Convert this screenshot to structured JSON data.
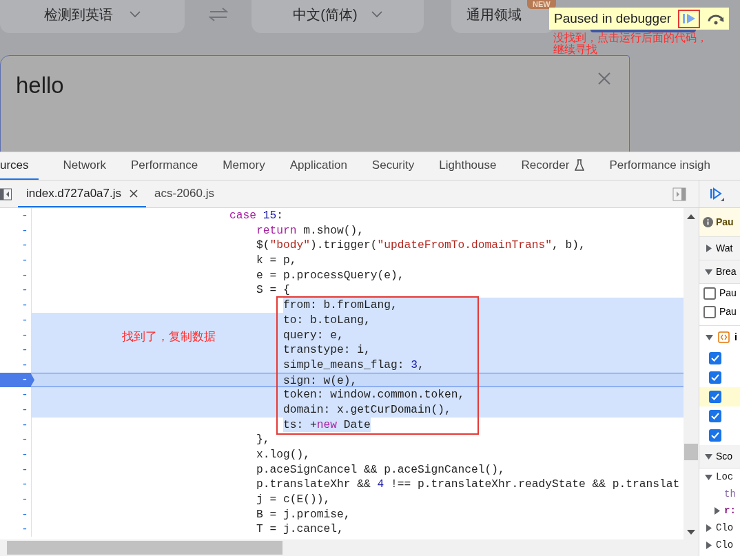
{
  "page": {
    "source_lang": "检测到英语",
    "target_lang": "中文(简体)",
    "domain": "通用领域",
    "badge": "NEW",
    "input_text": "hello"
  },
  "debugger_banner": {
    "text": "Paused in debugger"
  },
  "callout": {
    "lines": [
      "没找到，点击运行后面的代码，",
      "继续寻找"
    ]
  },
  "devtools_tabs": [
    {
      "label": "urces",
      "selected": true,
      "experimental": false
    },
    {
      "label": "Network",
      "selected": false,
      "experimental": false
    },
    {
      "label": "Performance",
      "selected": false,
      "experimental": false
    },
    {
      "label": "Memory",
      "selected": false,
      "experimental": false
    },
    {
      "label": "Application",
      "selected": false,
      "experimental": false
    },
    {
      "label": "Security",
      "selected": false,
      "experimental": false
    },
    {
      "label": "Lighthouse",
      "selected": false,
      "experimental": false
    },
    {
      "label": "Recorder",
      "selected": false,
      "experimental": true
    },
    {
      "label": "Performance insigh",
      "selected": false,
      "experimental": false
    }
  ],
  "file_tabs": [
    {
      "label": "index.d727a0a7.js",
      "selected": true,
      "closable": true
    },
    {
      "label": "acs-2060.js",
      "selected": false,
      "closable": false
    }
  ],
  "code": {
    "note": "找到了，复制数据",
    "lines": [
      {
        "marker": "-",
        "selected": false,
        "current": false,
        "tokens": [
          {
            "kind": "keyword",
            "text": "case"
          },
          {
            "kind": "number",
            "text": " 15"
          },
          {
            "kind": "plain",
            "text": ":"
          }
        ],
        "children": [
          {
            "marker": "-",
            "selected": false,
            "current": false,
            "tokens": [
              {
                "kind": "keyword",
                "text": "return"
              },
              {
                "kind": "plain",
                "text": " m.show(),"
              }
            ]
          },
          {
            "marker": "-",
            "selected": false,
            "current": false,
            "tokens": [
              {
                "kind": "plain",
                "text": "$("
              },
              {
                "kind": "string",
                "text": "\"body\""
              },
              {
                "kind": "plain",
                "text": ").trigger("
              },
              {
                "kind": "string",
                "text": "\"updateFromTo.domainTrans\""
              },
              {
                "kind": "plain",
                "text": ", b),"
              }
            ]
          },
          {
            "marker": "-",
            "selected": false,
            "current": false,
            "tokens": [
              {
                "kind": "plain",
                "text": "k = p,"
              }
            ]
          },
          {
            "marker": "-",
            "selected": false,
            "current": false,
            "tokens": [
              {
                "kind": "plain",
                "text": "e = p.processQuery(e),"
              }
            ]
          },
          {
            "marker": "-",
            "selected": false,
            "current": false,
            "tokens": [
              {
                "kind": "plain",
                "text": "S = {"
              }
            ],
            "children": [
              {
                "marker": "-",
                "selected": true,
                "current": false,
                "tokens": [
                  {
                    "kind": "plain",
                    "text": "from: b.fromLang,"
                  }
                ]
              },
              {
                "marker": "-",
                "selected": true,
                "current": false,
                "tokens": [
                  {
                    "kind": "plain",
                    "text": "to: b.toLang,"
                  }
                ]
              },
              {
                "marker": "-",
                "selected": true,
                "current": false,
                "tokens": [
                  {
                    "kind": "plain",
                    "text": "query: e,"
                  }
                ]
              },
              {
                "marker": "-",
                "selected": true,
                "current": false,
                "tokens": [
                  {
                    "kind": "plain",
                    "text": "transtype: i,"
                  }
                ]
              },
              {
                "marker": "-",
                "selected": true,
                "current": false,
                "tokens": [
                  {
                    "kind": "plain",
                    "text": "simple_means_flag: "
                  },
                  {
                    "kind": "number",
                    "text": "3"
                  },
                  {
                    "kind": "plain",
                    "text": ","
                  }
                ]
              },
              {
                "marker": "-",
                "selected": true,
                "current": true,
                "tokens": [
                  {
                    "kind": "plain",
                    "text": "sign: w(e),"
                  }
                ]
              },
              {
                "marker": "-",
                "selected": true,
                "current": false,
                "tokens": [
                  {
                    "kind": "plain",
                    "text": "token: window.common.token,"
                  }
                ]
              },
              {
                "marker": "-",
                "selected": true,
                "current": false,
                "tokens": [
                  {
                    "kind": "plain",
                    "text": "domain: x.getCurDomain(),"
                  }
                ]
              },
              {
                "marker": "-",
                "selected": true,
                "current": false,
                "tokens": [
                  {
                    "kind": "plain",
                    "text": "ts: +"
                  },
                  {
                    "kind": "keyword",
                    "text": "new"
                  },
                  {
                    "kind": "plain",
                    "text": " Date"
                  }
                ]
              }
            ]
          },
          {
            "marker": "-",
            "selected": false,
            "current": false,
            "tokens": [
              {
                "kind": "plain",
                "text": "},"
              }
            ]
          },
          {
            "marker": "-",
            "selected": false,
            "current": false,
            "tokens": [
              {
                "kind": "plain",
                "text": "x.log(),"
              }
            ]
          },
          {
            "marker": "-",
            "selected": false,
            "current": false,
            "tokens": [
              {
                "kind": "plain",
                "text": "p.aceSignCancel && p.aceSignCancel(),"
              }
            ]
          },
          {
            "marker": "-",
            "selected": false,
            "current": false,
            "tokens": [
              {
                "kind": "plain",
                "text": "p.translateXhr && "
              },
              {
                "kind": "number",
                "text": "4"
              },
              {
                "kind": "plain",
                "text": " !== p.translateXhr.readyState && p.translat"
              }
            ]
          },
          {
            "marker": "-",
            "selected": false,
            "current": false,
            "tokens": [
              {
                "kind": "plain",
                "text": "j = c(E()),"
              }
            ]
          },
          {
            "marker": "-",
            "selected": false,
            "current": false,
            "tokens": [
              {
                "kind": "plain",
                "text": "B = j.promise,"
              }
            ]
          },
          {
            "marker": "-",
            "selected": false,
            "current": false,
            "tokens": [
              {
                "kind": "plain",
                "text": "T = j.cancel,"
              }
            ]
          }
        ]
      }
    ]
  },
  "sidebar": {
    "items": [
      {
        "kind": "banner",
        "text": "Pau"
      },
      {
        "kind": "section",
        "text": "Wat",
        "expanded": false
      },
      {
        "kind": "section",
        "text": "Brea",
        "expanded": true
      },
      {
        "kind": "option",
        "text": "Pau",
        "checked": false
      },
      {
        "kind": "option",
        "text": "Pau",
        "checked": false
      },
      {
        "kind": "file",
        "text": "i",
        "expanded": true
      },
      {
        "kind": "breakpoint",
        "checked": true,
        "selected": false
      },
      {
        "kind": "breakpoint",
        "checked": true,
        "selected": false
      },
      {
        "kind": "breakpoint",
        "checked": true,
        "selected": true
      },
      {
        "kind": "breakpoint",
        "checked": true,
        "selected": false
      },
      {
        "kind": "breakpoint",
        "checked": true,
        "selected": false
      },
      {
        "kind": "section",
        "text": "Sco",
        "expanded": true
      },
      {
        "kind": "tree",
        "text": "Loc",
        "expanded": true,
        "children": [
          {
            "kind": "leaf",
            "text": "th"
          },
          {
            "kind": "tree",
            "text": "r:",
            "expanded": false
          }
        ]
      },
      {
        "kind": "tree",
        "text": "Clo",
        "expanded": false
      },
      {
        "kind": "tree",
        "text": "Clo",
        "expanded": false
      }
    ]
  }
}
